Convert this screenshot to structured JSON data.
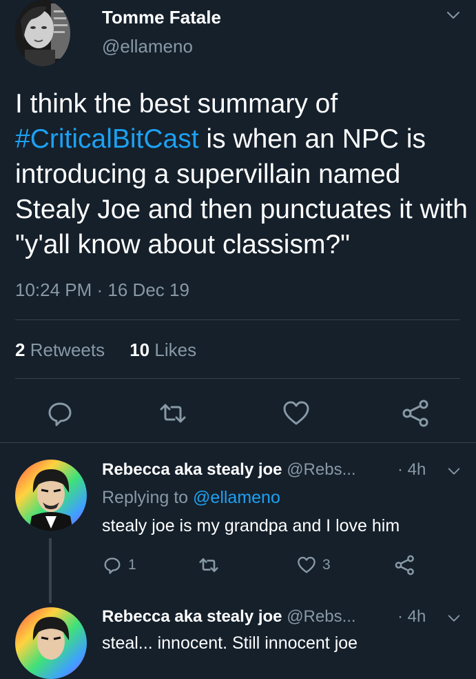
{
  "tweet": {
    "author_name": "Tomme Fatale",
    "author_handle": "@ellameno",
    "text_before": "I think the best summary of ",
    "hashtag": "#CriticalBitCast",
    "text_after": " is when an NPC is introducing a supervillain named Stealy Joe and then punctuates it with \"y'all know about classism?\"",
    "timestamp": "10:24 PM · 16 Dec 19",
    "retweets_count": "2",
    "retweets_label": "Retweets",
    "likes_count": "10",
    "likes_label": "Likes",
    "avatar_icon": "profile-photo"
  },
  "replies": [
    {
      "author_name": "Rebecca aka stealy joe",
      "author_handle": "@Rebs...",
      "time": "· 4h",
      "replying_to_prefix": "Replying to ",
      "replying_to_handle": "@ellameno",
      "text": "stealy joe is my grandpa and I love him",
      "reply_count": "1",
      "like_count": "3"
    },
    {
      "author_name": "Rebecca aka stealy joe",
      "author_handle": "@Rebs...",
      "time": "· 4h",
      "text": "steal... innocent. Still innocent joe"
    }
  ],
  "colors": {
    "background": "#15202b",
    "accent": "#1da1f2",
    "muted": "#8899a6",
    "divider": "#38444d"
  }
}
